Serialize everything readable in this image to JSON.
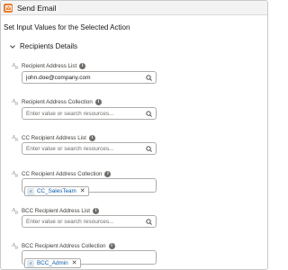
{
  "header": {
    "title": "Send Email",
    "icon": "email-action-icon",
    "icon_color": "#e97d2e"
  },
  "subtitle": "Set Input Values for the Selected Action",
  "section": {
    "title": "Recipients Details",
    "expanded": true
  },
  "fields": [
    {
      "label": "Recipient Address List",
      "type": "input",
      "value": "john.doe@company.com",
      "placeholder": ""
    },
    {
      "label": "Recipient Address Collection",
      "type": "input",
      "value": "",
      "placeholder": "Enter value or search resources..."
    },
    {
      "label": "CC Recipient Address List",
      "type": "input",
      "value": "",
      "placeholder": "Enter value or search resources..."
    },
    {
      "label": "CC Recipient Address Collection",
      "type": "pill",
      "pill": "CC_SalesTeam"
    },
    {
      "label": "BCC Recipient Address List",
      "type": "input",
      "value": "",
      "placeholder": "Enter value or search resources..."
    },
    {
      "label": "BCC Recipient Address Collection",
      "type": "pill",
      "pill": "BCC_Admin"
    }
  ],
  "type_icon_text": "A",
  "type_icon_sub": "B",
  "info_glyph": "i",
  "close_glyph": "✕",
  "colors": {
    "accent": "#e97d2e",
    "pill_text": "#0b5cab"
  }
}
